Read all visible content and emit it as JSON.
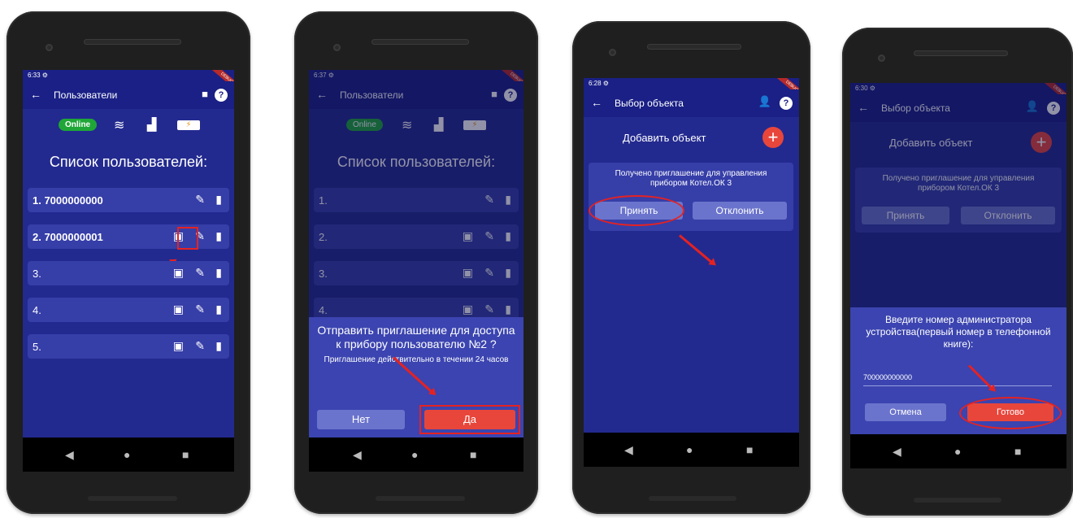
{
  "phone1": {
    "time": "6:33",
    "title": "Пользователи",
    "online": "Online",
    "list_title": "Список пользователей:",
    "users": [
      "1. 7000000000",
      "2. 7000000001",
      "3.",
      "4.",
      "5."
    ]
  },
  "phone2": {
    "time": "6:37",
    "title": "Пользователи",
    "online": "Online",
    "list_title": "Список пользователей:",
    "users": [
      "1.",
      "2.",
      "3.",
      "4."
    ],
    "dialog_text": "Отправить приглашение для доступа к прибору пользователю №2 ?",
    "dialog_sub": "Приглашение действительно в течении 24 часов",
    "no_label": "Нет",
    "yes_label": "Да"
  },
  "phone3": {
    "time": "6:28",
    "title": "Выбор объекта",
    "add_object": "Добавить объект",
    "invite_text": "Получено приглашение для управления прибором Котел.ОК 3",
    "accept_label": "Принять",
    "decline_label": "Отклонить"
  },
  "phone4": {
    "time": "6:30",
    "title": "Выбор объекта",
    "add_object": "Добавить объект",
    "invite_text": "Получено приглашение для управления прибором Котел.ОК 3",
    "accept_label": "Принять",
    "decline_label": "Отклонить",
    "dialog_text": "Введите номер администратора устройства(первый номер в телефонной книге):",
    "phone_value": "700000000000",
    "cancel_label": "Отмена",
    "done_label": "Готово"
  },
  "colors": {
    "screen_bg": "#232a8f",
    "appbar": "#1a2085",
    "row": "#363ea8",
    "accent_red": "#e8463b",
    "online_green": "#1fa637"
  }
}
